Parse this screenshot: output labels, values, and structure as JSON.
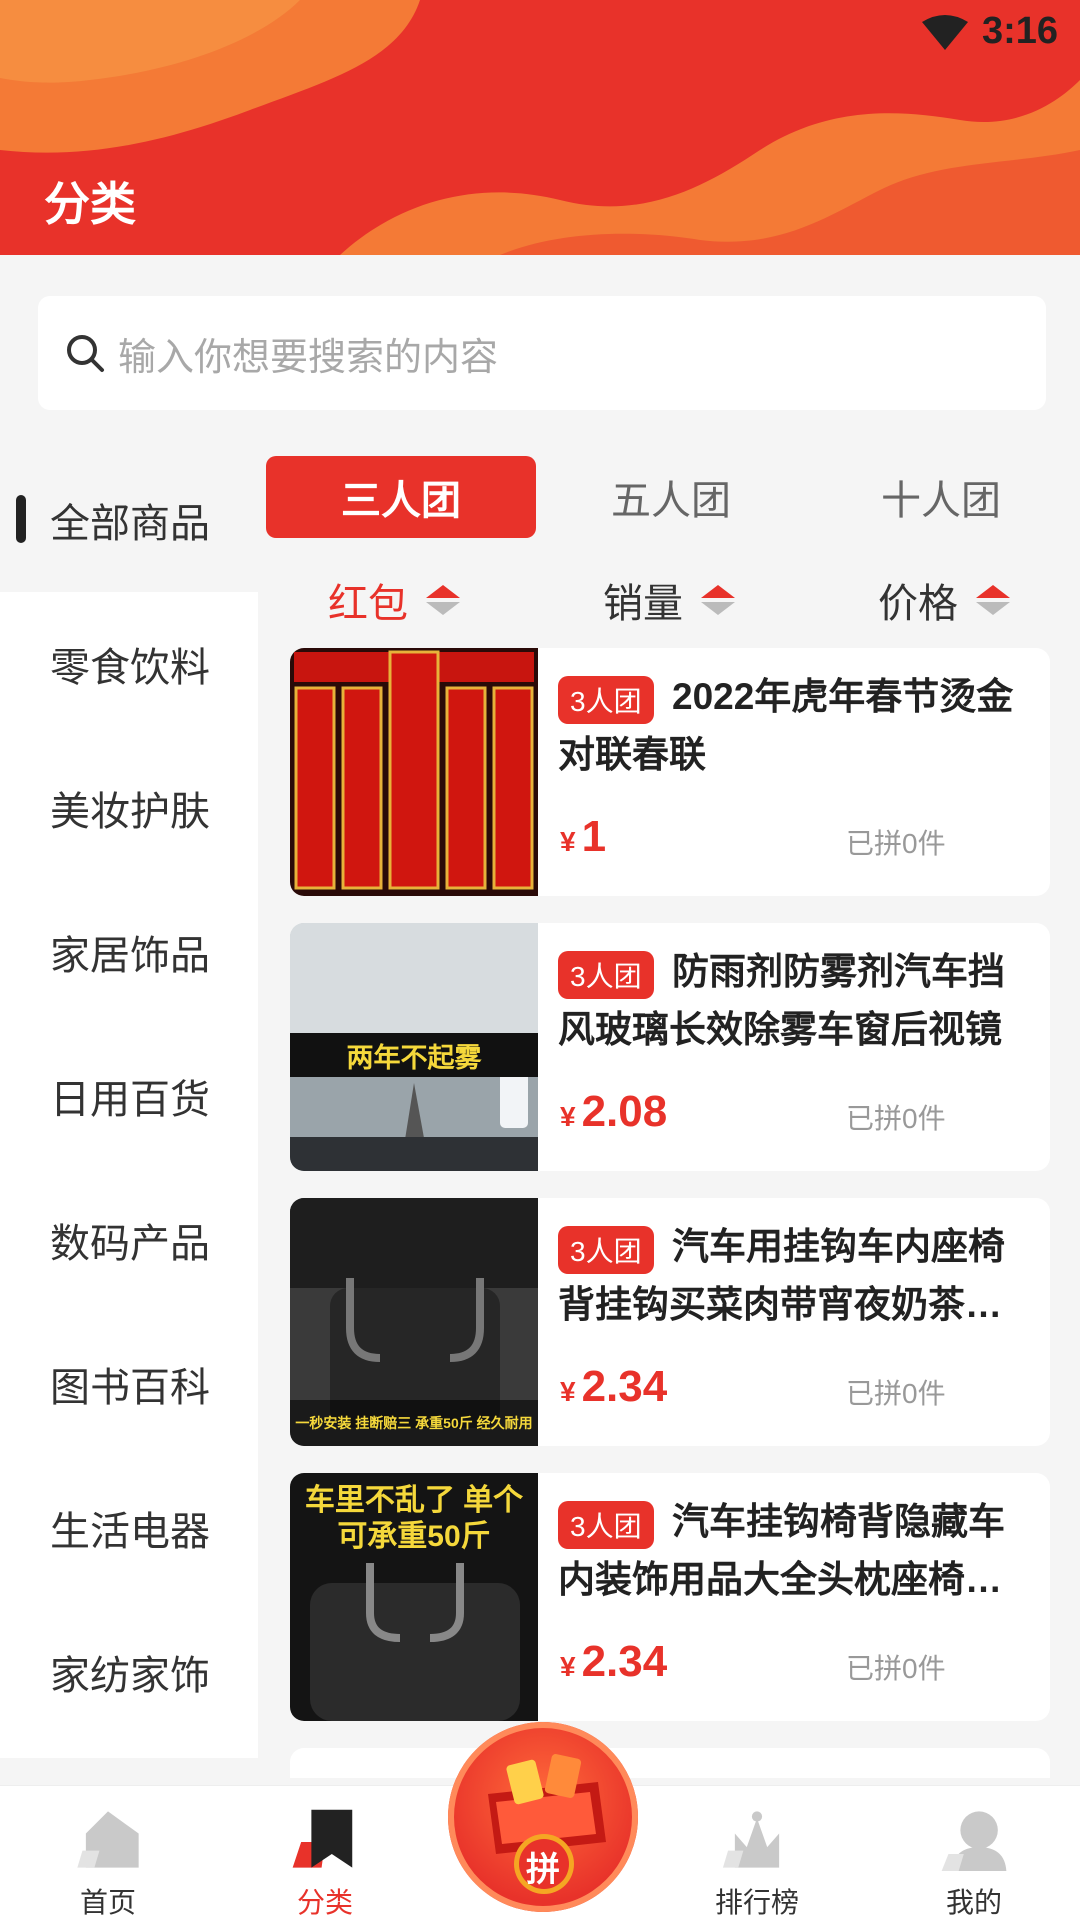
{
  "status_bar": {
    "time": "3:16"
  },
  "header": {
    "title": "分类"
  },
  "search": {
    "placeholder": "输入你想要搜索的内容"
  },
  "sidebar": {
    "items": [
      {
        "label": "全部商品",
        "active": true
      },
      {
        "label": "零食饮料"
      },
      {
        "label": "美妆护肤"
      },
      {
        "label": "家居饰品"
      },
      {
        "label": "日用百货"
      },
      {
        "label": "数码产品"
      },
      {
        "label": "图书百科"
      },
      {
        "label": "生活电器"
      },
      {
        "label": "家纺家饰"
      }
    ]
  },
  "group_tabs": [
    {
      "label": "三人团",
      "active": true
    },
    {
      "label": "五人团"
    },
    {
      "label": "十人团"
    }
  ],
  "sort_options": [
    {
      "label": "红包",
      "active": true
    },
    {
      "label": "销量"
    },
    {
      "label": "价格"
    }
  ],
  "products": [
    {
      "badge": "3人团",
      "title": "2022年虎年春节烫金对联春联",
      "currency": "¥",
      "price": "1",
      "sold": "已拼0件"
    },
    {
      "badge": "3人团",
      "title": "防雨剂防雾剂汽车挡风玻璃长效除雾车窗后视镜",
      "currency": "¥",
      "price": "2.08",
      "sold": "已拼0件",
      "image_text": "两年不起雾"
    },
    {
      "badge": "3人团",
      "title": "汽车用挂钩车内座椅背挂钩买菜肉带宵夜奶茶挂钩",
      "currency": "¥",
      "price": "2.34",
      "sold": "已拼0件",
      "image_text": "一秒安装 挂断赔三 承重50斤 经久耐用"
    },
    {
      "badge": "3人团",
      "title": "汽车挂钩椅背隐藏车内装饰用品大全头枕座椅挂钩",
      "currency": "¥",
      "price": "2.34",
      "sold": "已拼0件",
      "image_text": "车里不乱了 单个可承重50斤"
    }
  ],
  "bottom_nav": [
    {
      "label": "首页",
      "icon": "home-icon"
    },
    {
      "label": "分类",
      "icon": "bookmark-icon",
      "active": true
    },
    {
      "label": "拼",
      "icon": "gift-box-icon"
    },
    {
      "label": "排行榜",
      "icon": "crown-icon"
    },
    {
      "label": "我的",
      "icon": "user-icon"
    }
  ],
  "colors": {
    "accent": "#e8322a",
    "accent_light": "#f7893c",
    "background": "#f5f5f5"
  }
}
